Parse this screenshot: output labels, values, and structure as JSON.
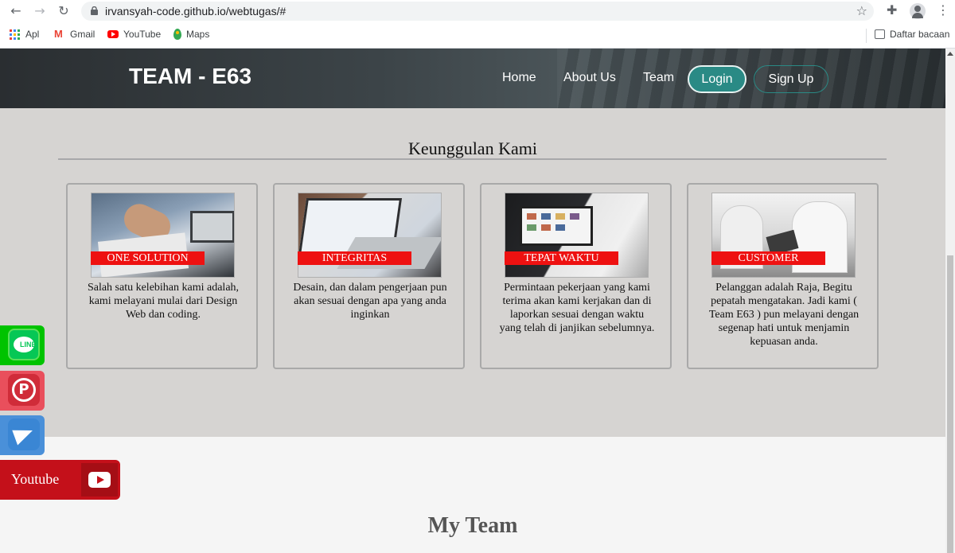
{
  "browser": {
    "url": "irvansyah-code.github.io/webtugas/#",
    "bookmarks": [
      "Apl",
      "Gmail",
      "YouTube",
      "Maps"
    ],
    "reading_list": "Daftar bacaan"
  },
  "site": {
    "brand": "TEAM - E63",
    "nav": [
      "Home",
      "About Us",
      "Team"
    ],
    "login": "Login",
    "signup": "Sign Up"
  },
  "features": {
    "title": "Keunggulan Kami",
    "cards": [
      {
        "label": "ONE SOLUTION",
        "text": "Salah satu kelebihan kami adalah, kami melayani mulai dari Design Web dan coding."
      },
      {
        "label": "INTEGRITAS",
        "text": "Desain, dan dalam pengerjaan pun akan sesuai dengan apa yang anda inginkan"
      },
      {
        "label": "TEPAT WAKTU",
        "text": "Permintaan pekerjaan yang kami terima akan kami kerjakan dan di laporkan sesuai dengan waktu yang telah di janjikan sebelumnya."
      },
      {
        "label": "CUSTOMER",
        "text": "Pelanggan adalah Raja, Begitu pepatah mengatakan. Jadi kami ( Team E63 ) pun melayani dengan segenap hati untuk menjamin kepuasan anda."
      }
    ]
  },
  "social": {
    "line_text": "LINE",
    "youtube_label": "Youtube"
  },
  "team_title": "My Team"
}
